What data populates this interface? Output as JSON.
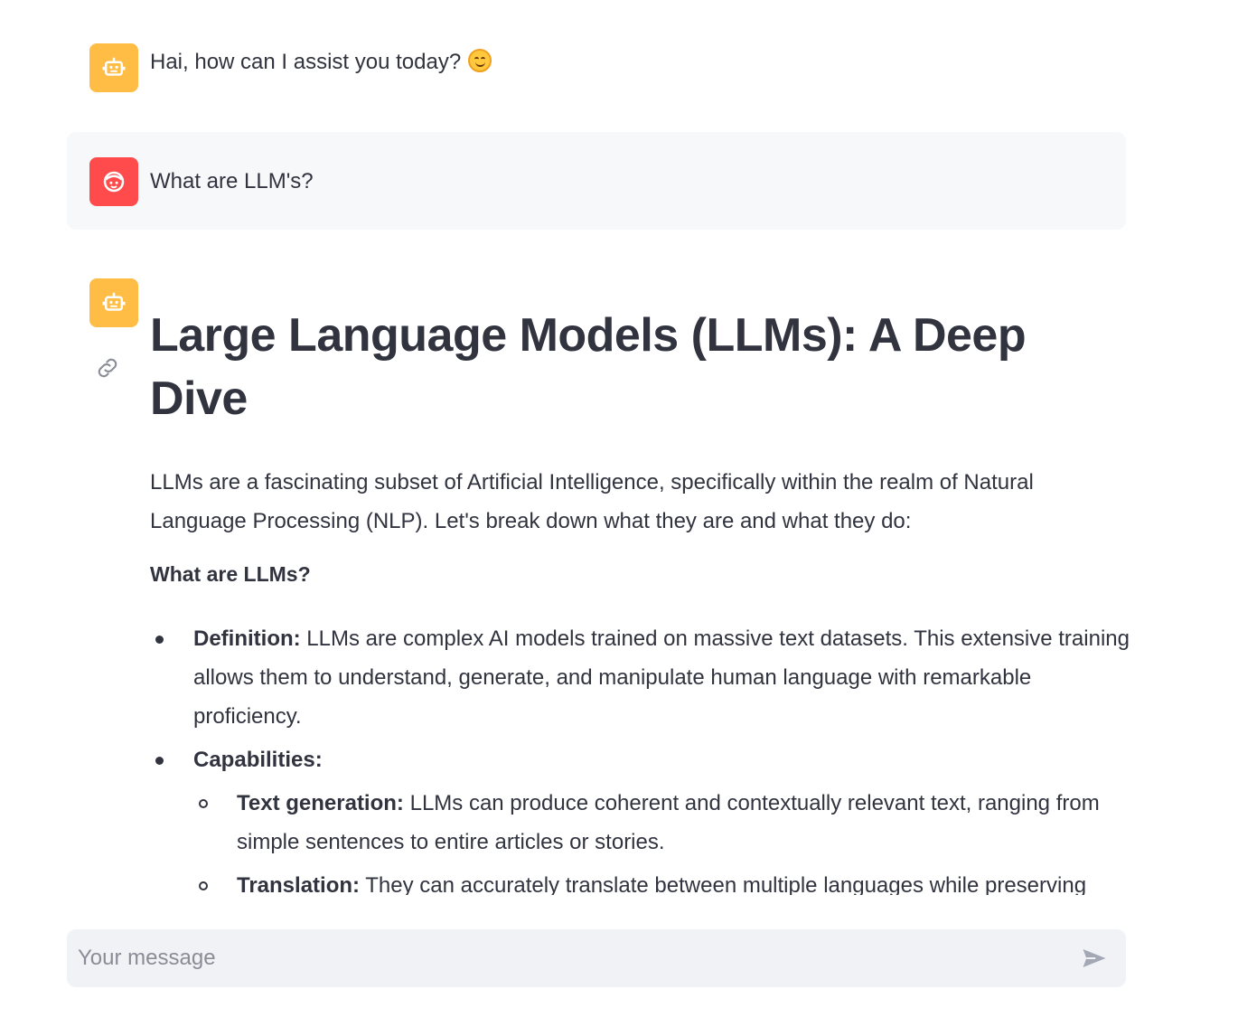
{
  "chat": {
    "greeting": {
      "text": "Hai, how can I assist you today?",
      "emoji": "smiling-face-icon"
    },
    "user_message": {
      "text": "What are LLM's?"
    },
    "response": {
      "title": "Large Language Models (LLMs): A Deep Dive",
      "intro": "LLMs are a fascinating subset of Artificial Intelligence, specifically within the realm of Natural Language Processing (NLP). Let's break down what they are and what they do:",
      "section_heading": "What are LLMs?",
      "bullets": [
        {
          "label": "Definition:",
          "text": " LLMs are complex AI models trained on massive text datasets. This extensive training allows them to understand, generate, and manipulate human language with remarkable proficiency."
        },
        {
          "label": "Capabilities:",
          "text": ""
        }
      ],
      "sub_bullets": [
        {
          "label": "Text generation:",
          "text": " LLMs can produce coherent and contextually relevant text, ranging from simple sentences to entire articles or stories."
        },
        {
          "label": "Translation:",
          "text": " They can accurately translate between multiple languages while preserving"
        }
      ]
    }
  },
  "input": {
    "placeholder": "Your message"
  },
  "colors": {
    "bot_avatar": "#ffbd45",
    "user_avatar": "#ff4b4b",
    "user_message_bg": "#f7f8fa",
    "input_bg": "#f0f2f6",
    "text": "#31333f"
  }
}
